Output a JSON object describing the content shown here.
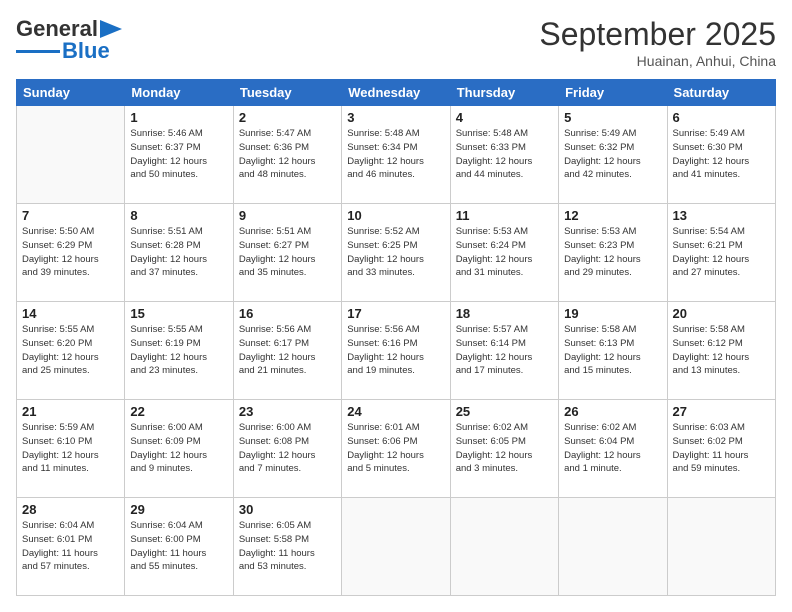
{
  "header": {
    "logo_main": "General",
    "logo_sub": "Blue",
    "month_title": "September 2025",
    "subtitle": "Huainan, Anhui, China"
  },
  "days_of_week": [
    "Sunday",
    "Monday",
    "Tuesday",
    "Wednesday",
    "Thursday",
    "Friday",
    "Saturday"
  ],
  "weeks": [
    [
      {
        "day": "",
        "info": ""
      },
      {
        "day": "1",
        "info": "Sunrise: 5:46 AM\nSunset: 6:37 PM\nDaylight: 12 hours\nand 50 minutes."
      },
      {
        "day": "2",
        "info": "Sunrise: 5:47 AM\nSunset: 6:36 PM\nDaylight: 12 hours\nand 48 minutes."
      },
      {
        "day": "3",
        "info": "Sunrise: 5:48 AM\nSunset: 6:34 PM\nDaylight: 12 hours\nand 46 minutes."
      },
      {
        "day": "4",
        "info": "Sunrise: 5:48 AM\nSunset: 6:33 PM\nDaylight: 12 hours\nand 44 minutes."
      },
      {
        "day": "5",
        "info": "Sunrise: 5:49 AM\nSunset: 6:32 PM\nDaylight: 12 hours\nand 42 minutes."
      },
      {
        "day": "6",
        "info": "Sunrise: 5:49 AM\nSunset: 6:30 PM\nDaylight: 12 hours\nand 41 minutes."
      }
    ],
    [
      {
        "day": "7",
        "info": "Sunrise: 5:50 AM\nSunset: 6:29 PM\nDaylight: 12 hours\nand 39 minutes."
      },
      {
        "day": "8",
        "info": "Sunrise: 5:51 AM\nSunset: 6:28 PM\nDaylight: 12 hours\nand 37 minutes."
      },
      {
        "day": "9",
        "info": "Sunrise: 5:51 AM\nSunset: 6:27 PM\nDaylight: 12 hours\nand 35 minutes."
      },
      {
        "day": "10",
        "info": "Sunrise: 5:52 AM\nSunset: 6:25 PM\nDaylight: 12 hours\nand 33 minutes."
      },
      {
        "day": "11",
        "info": "Sunrise: 5:53 AM\nSunset: 6:24 PM\nDaylight: 12 hours\nand 31 minutes."
      },
      {
        "day": "12",
        "info": "Sunrise: 5:53 AM\nSunset: 6:23 PM\nDaylight: 12 hours\nand 29 minutes."
      },
      {
        "day": "13",
        "info": "Sunrise: 5:54 AM\nSunset: 6:21 PM\nDaylight: 12 hours\nand 27 minutes."
      }
    ],
    [
      {
        "day": "14",
        "info": "Sunrise: 5:55 AM\nSunset: 6:20 PM\nDaylight: 12 hours\nand 25 minutes."
      },
      {
        "day": "15",
        "info": "Sunrise: 5:55 AM\nSunset: 6:19 PM\nDaylight: 12 hours\nand 23 minutes."
      },
      {
        "day": "16",
        "info": "Sunrise: 5:56 AM\nSunset: 6:17 PM\nDaylight: 12 hours\nand 21 minutes."
      },
      {
        "day": "17",
        "info": "Sunrise: 5:56 AM\nSunset: 6:16 PM\nDaylight: 12 hours\nand 19 minutes."
      },
      {
        "day": "18",
        "info": "Sunrise: 5:57 AM\nSunset: 6:14 PM\nDaylight: 12 hours\nand 17 minutes."
      },
      {
        "day": "19",
        "info": "Sunrise: 5:58 AM\nSunset: 6:13 PM\nDaylight: 12 hours\nand 15 minutes."
      },
      {
        "day": "20",
        "info": "Sunrise: 5:58 AM\nSunset: 6:12 PM\nDaylight: 12 hours\nand 13 minutes."
      }
    ],
    [
      {
        "day": "21",
        "info": "Sunrise: 5:59 AM\nSunset: 6:10 PM\nDaylight: 12 hours\nand 11 minutes."
      },
      {
        "day": "22",
        "info": "Sunrise: 6:00 AM\nSunset: 6:09 PM\nDaylight: 12 hours\nand 9 minutes."
      },
      {
        "day": "23",
        "info": "Sunrise: 6:00 AM\nSunset: 6:08 PM\nDaylight: 12 hours\nand 7 minutes."
      },
      {
        "day": "24",
        "info": "Sunrise: 6:01 AM\nSunset: 6:06 PM\nDaylight: 12 hours\nand 5 minutes."
      },
      {
        "day": "25",
        "info": "Sunrise: 6:02 AM\nSunset: 6:05 PM\nDaylight: 12 hours\nand 3 minutes."
      },
      {
        "day": "26",
        "info": "Sunrise: 6:02 AM\nSunset: 6:04 PM\nDaylight: 12 hours\nand 1 minute."
      },
      {
        "day": "27",
        "info": "Sunrise: 6:03 AM\nSunset: 6:02 PM\nDaylight: 11 hours\nand 59 minutes."
      }
    ],
    [
      {
        "day": "28",
        "info": "Sunrise: 6:04 AM\nSunset: 6:01 PM\nDaylight: 11 hours\nand 57 minutes."
      },
      {
        "day": "29",
        "info": "Sunrise: 6:04 AM\nSunset: 6:00 PM\nDaylight: 11 hours\nand 55 minutes."
      },
      {
        "day": "30",
        "info": "Sunrise: 6:05 AM\nSunset: 5:58 PM\nDaylight: 11 hours\nand 53 minutes."
      },
      {
        "day": "",
        "info": ""
      },
      {
        "day": "",
        "info": ""
      },
      {
        "day": "",
        "info": ""
      },
      {
        "day": "",
        "info": ""
      }
    ]
  ]
}
